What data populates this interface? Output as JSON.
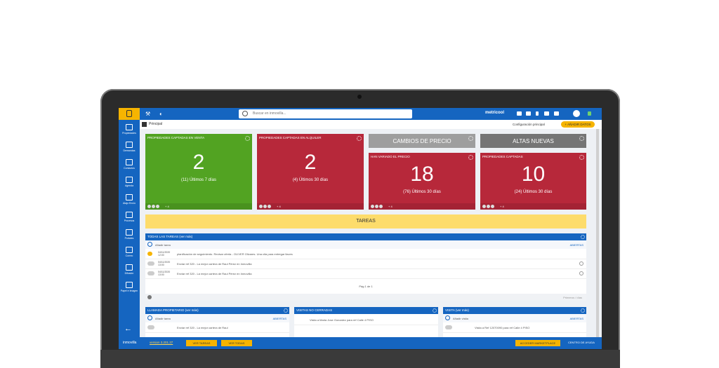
{
  "topbar": {
    "search_placeholder": "Buscar en inmovilla...",
    "brand": "metricool"
  },
  "sidebar": {
    "items": [
      {
        "label": "Propiedades"
      },
      {
        "label": "Demandas"
      },
      {
        "label": "Contactos"
      },
      {
        "label": "Agenda"
      },
      {
        "label": "Atajo Envío"
      },
      {
        "label": "Procesos"
      },
      {
        "label": "Portales"
      },
      {
        "label": "Correo"
      },
      {
        "label": "Difusión"
      },
      {
        "label": "Papel e Imagen"
      }
    ]
  },
  "subheader": {
    "selector": "Principal",
    "config": "Configuración principal",
    "add_button": "+ AÑADIR DATOS"
  },
  "cards": {
    "venta": {
      "title": "PROPIEDADES CAPTADAS EN VENTA",
      "number": "2",
      "sub": "(11) Últimos 7 días",
      "foot": "+ 4"
    },
    "alquiler": {
      "title": "PROPIEDADES CAPTADAS EN ALQUILER",
      "number": "2",
      "sub": "(4) Últimos 30 días",
      "foot": "+ 4"
    },
    "cambios": {
      "header": "CAMBIOS DE PRECIO",
      "title": "HAN VARIADO EL PRECIO",
      "number": "18",
      "sub": "(76) Últimos 30 días",
      "foot": "+ 4"
    },
    "altas": {
      "header": "ALTAS NUEVAS",
      "title": "PROPIEDADES CAPTADAS",
      "number": "10",
      "sub": "(24) Últimos 30 días",
      "foot": "+ 4"
    }
  },
  "tareas": {
    "bar": "TAREAS",
    "panel_title": "TODAS LAS TAREAS (ver más)",
    "add_label": "Añadir tarea",
    "add_right": "ABIERTAS",
    "rows": [
      {
        "date": "04/11/2020 12:00",
        "text": "planificación de seguimiento. Revisar oferta - OLIVER Olivares. Una cita para entregar llaves"
      },
      {
        "date": "04/11/2020 13:00",
        "text": "Enviar ref 320 - La mejor cartera de Raul Pérez en Inmovilla"
      },
      {
        "date": "04/11/2020 13:00",
        "text": "Enviar ref 320 - La mejor cartera de Raul Pérez en Inmovilla"
      }
    ],
    "pager": "Pág 1 de 1",
    "footer_right": "Primeros / días"
  },
  "panels_bottom": [
    {
      "title": "LLAMADA PROPIETARIO (ver más)",
      "add": "Añadir tarea",
      "right": "ABIERTAS",
      "row": "Enviar ref 320 - La mejor cartera de Raul"
    },
    {
      "title": "VISITAS NO CERRADAS",
      "add": "",
      "right": "",
      "row": "Visita a Maria Jose Gonzalez para ref Calle 4 PISO"
    },
    {
      "title": "VISITA (ver más)",
      "add": "Añadir visita",
      "right": "ABIERTAS",
      "row": "Visita a Ref 12070090 para ref Calle 4 PISO"
    }
  ],
  "bottombar": {
    "brand": "inmovilla",
    "version": "version 3.201.37",
    "btn1": "VER TAREAS",
    "btn2": "VER TODAS",
    "btn3": "ACCEDER MARKETPLACE",
    "right": "CENTRO DE AYUDA"
  }
}
